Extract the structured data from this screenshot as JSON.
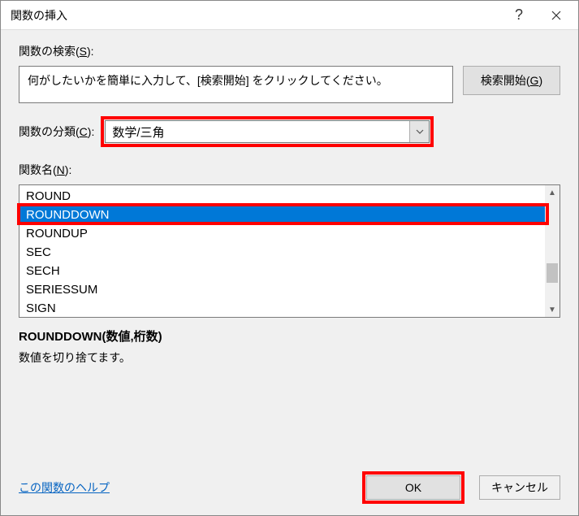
{
  "titlebar": {
    "title": "関数の挿入"
  },
  "labels": {
    "search": "関数の検索(",
    "search_key": "S",
    "search_suffix": "):",
    "category": "関数の分類(",
    "category_key": "C",
    "category_suffix": "):",
    "name": "関数名(",
    "name_key": "N",
    "name_suffix": "):"
  },
  "search": {
    "text": "何がしたいかを簡単に入力して、[検索開始] をクリックしてください。",
    "start_btn": "検索開始(",
    "start_key": "G",
    "start_suffix": ")"
  },
  "category": {
    "value": "数学/三角"
  },
  "functions": {
    "items": [
      "ROUND",
      "ROUNDDOWN",
      "ROUNDUP",
      "SEC",
      "SECH",
      "SERIESSUM",
      "SIGN"
    ],
    "selected_index": 1
  },
  "detail": {
    "syntax": "ROUNDDOWN(数値,桁数)",
    "desc": "数値を切り捨てます。"
  },
  "footer": {
    "help": "この関数のヘルプ",
    "ok": "OK",
    "cancel": "キャンセル"
  }
}
